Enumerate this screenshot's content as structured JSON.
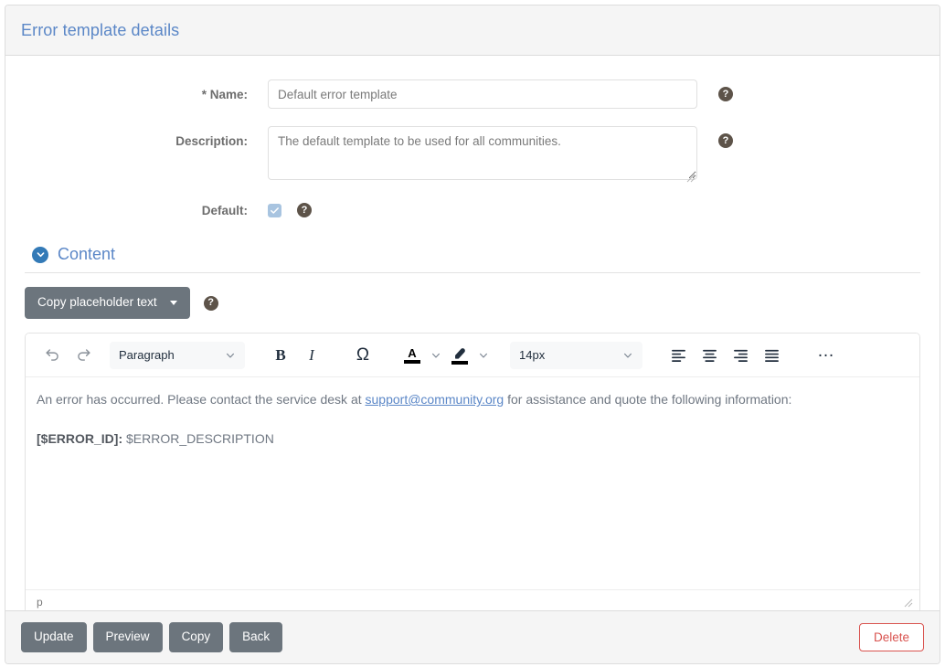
{
  "header": {
    "title": "Error template details"
  },
  "form": {
    "name": {
      "label": "* Name:",
      "value": "Default error template",
      "help": "?"
    },
    "description": {
      "label": "Description:",
      "value": "The default template to be used for all communities.",
      "help": "?"
    },
    "default": {
      "label": "Default:",
      "checked": true,
      "help": "?"
    }
  },
  "content_section": {
    "title": "Content",
    "chevron_icon": "chevron-down-icon",
    "copy_placeholder": {
      "label": "Copy placeholder text",
      "help": "?"
    }
  },
  "editor": {
    "toolbar": {
      "undo": "undo-icon",
      "redo": "redo-icon",
      "block_format": "Paragraph",
      "bold": "B",
      "italic": "I",
      "special_char": "Ω",
      "text_color": "A",
      "highlight": "highlight-icon",
      "font_size": "14px",
      "align_left": "align-left-icon",
      "align_center": "align-center-icon",
      "align_right": "align-right-icon",
      "align_justify": "align-justify-icon",
      "more": "…"
    },
    "body": {
      "paragraph1_before": "An error has occurred. Please contact the service desk at ",
      "paragraph1_link": "support@community.org",
      "paragraph1_after": " for assistance and quote the following information:",
      "paragraph2_bold": "[$ERROR_ID]:",
      "paragraph2_rest": " $ERROR_DESCRIPTION"
    },
    "status_path": "p"
  },
  "footer": {
    "update": "Update",
    "preview": "Preview",
    "copy": "Copy",
    "back": "Back",
    "delete": "Delete"
  },
  "colors": {
    "header_title": "#5b87c7",
    "button": "#6c757d",
    "danger": "#d9534f",
    "accent": "#337ab7",
    "checkbox": "#a8c4e0"
  }
}
